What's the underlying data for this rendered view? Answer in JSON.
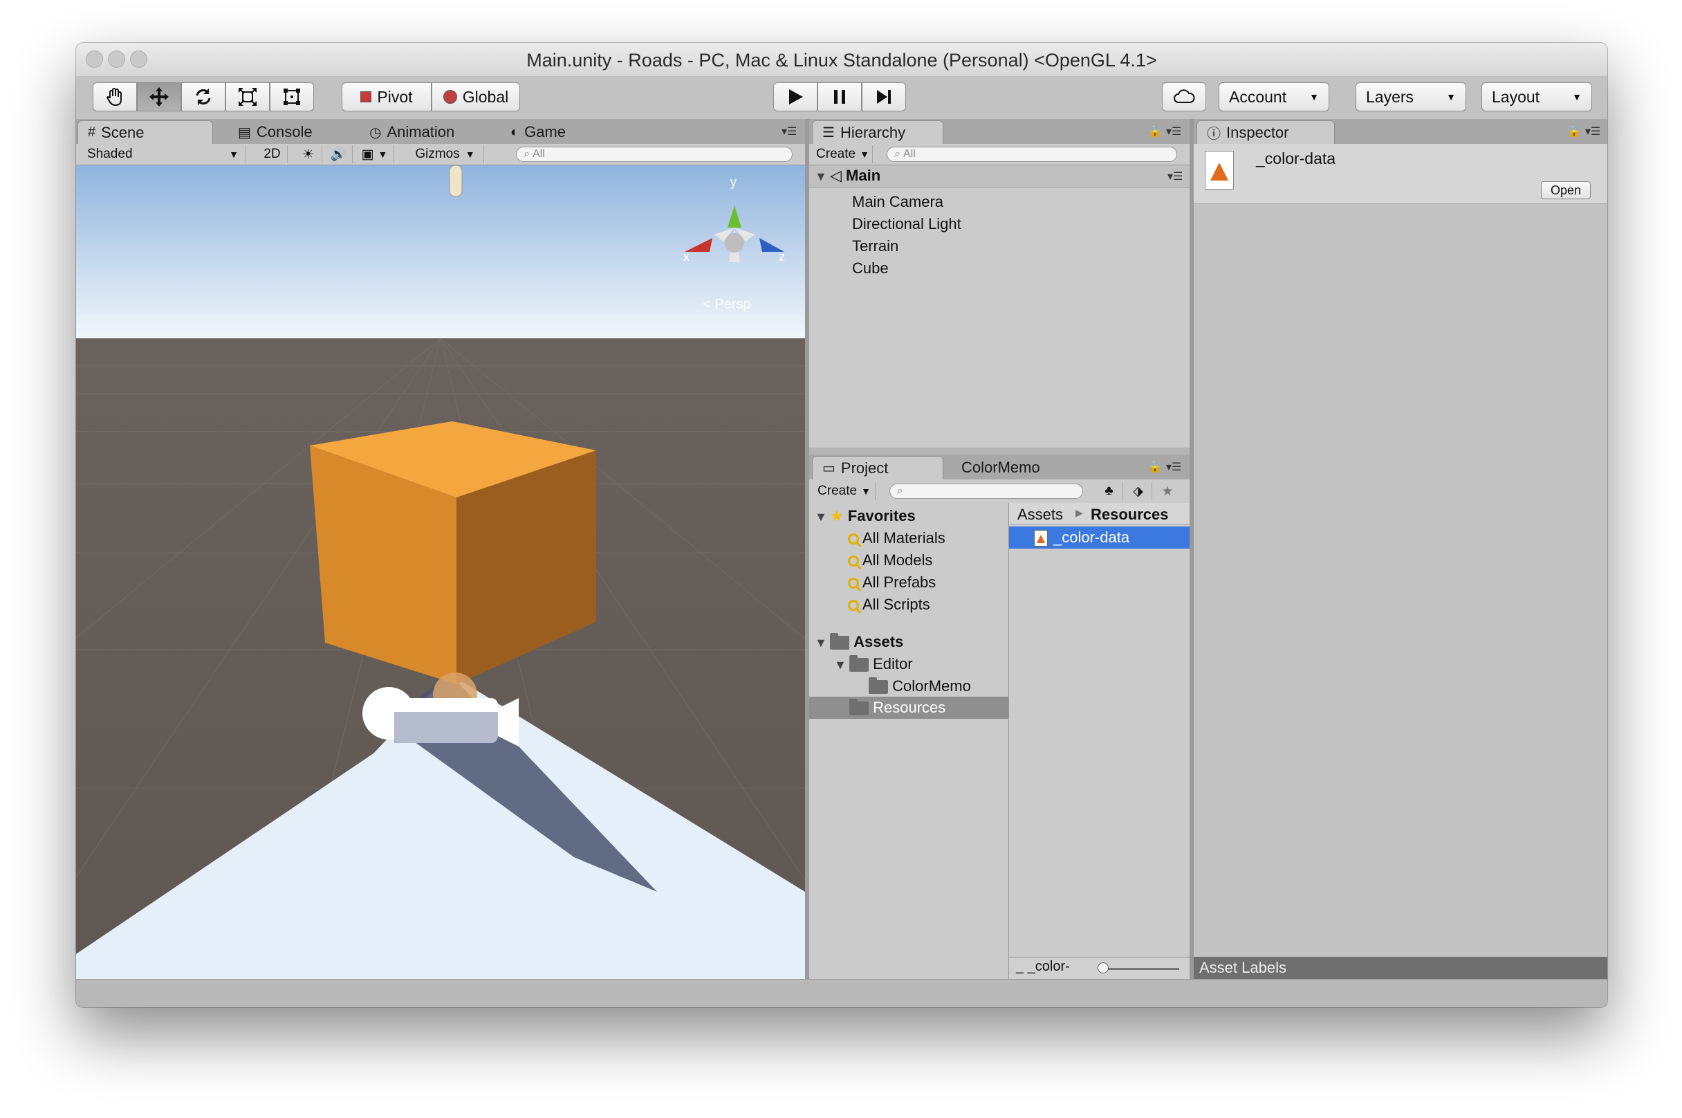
{
  "window": {
    "title": "Main.unity - Roads - PC, Mac & Linux Standalone (Personal) <OpenGL 4.1>"
  },
  "toolbar": {
    "tools": [
      "hand-tool",
      "move-tool",
      "rotate-tool",
      "scale-tool",
      "rect-tool"
    ],
    "pivot_label": "Pivot",
    "global_label": "Global",
    "account_label": "Account",
    "layers_label": "Layers",
    "layout_label": "Layout"
  },
  "scene_tabs": {
    "scene": "Scene",
    "console": "Console",
    "animation": "Animation",
    "game": "Game"
  },
  "scene_bar": {
    "shading": "Shaded",
    "mode_2d": "2D",
    "gizmos": "Gizmos",
    "search_placeholder": "All"
  },
  "scene_view": {
    "axis_y": "y",
    "axis_x": "x",
    "axis_z": "z",
    "projection": "Persp",
    "cube_colors": {
      "top": "#f4a73e",
      "left": "#d88a2a",
      "right": "#9a5f1e"
    }
  },
  "hierarchy": {
    "tab": "Hierarchy",
    "create_label": "Create",
    "search_placeholder": "All",
    "scene_name": "Main",
    "objects": [
      "Main Camera",
      "Directional Light",
      "Terrain",
      "Cube"
    ]
  },
  "project": {
    "tab": "Project",
    "tab2": "ColorMemo",
    "create_label": "Create",
    "favorites_label": "Favorites",
    "favorites": [
      "All Materials",
      "All Models",
      "All Prefabs",
      "All Scripts"
    ],
    "assets_label": "Assets",
    "editor_label": "Editor",
    "colormemo_folder": "ColorMemo",
    "resources_label": "Resources",
    "breadcrumb": {
      "root": "Assets",
      "current": "Resources"
    },
    "selected_file": "_color-data",
    "footer_label": "_color-",
    "selection_color": "#3b78e0"
  },
  "inspector": {
    "tab": "Inspector",
    "asset_name": "_color-data",
    "open_label": "Open",
    "asset_labels": "Asset Labels"
  }
}
